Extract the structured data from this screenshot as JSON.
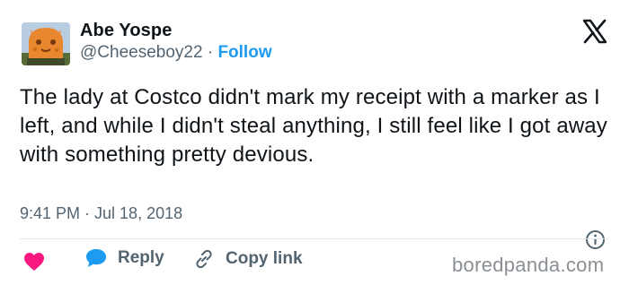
{
  "author": {
    "display_name": "Abe Yospe",
    "handle": "@Cheeseboy22",
    "separator": " · ",
    "follow_label": "Follow"
  },
  "tweet": {
    "text": "The lady at Costco didn't mark my receipt with a marker as I left, and while I didn't steal anything, I still feel like I got away with something pretty devious.",
    "timestamp": "9:41 PM · Jul 18, 2018"
  },
  "actions": {
    "reply_label": "Reply",
    "copy_label": "Copy link"
  },
  "watermark": "boredpanda.com",
  "colors": {
    "text": "#0f1419",
    "muted": "#536471",
    "accent": "#1d9bf0",
    "like": "#f91880"
  },
  "icons": [
    "x-logo-icon",
    "info-icon",
    "heart-icon",
    "speech-bubble-icon",
    "link-icon"
  ]
}
